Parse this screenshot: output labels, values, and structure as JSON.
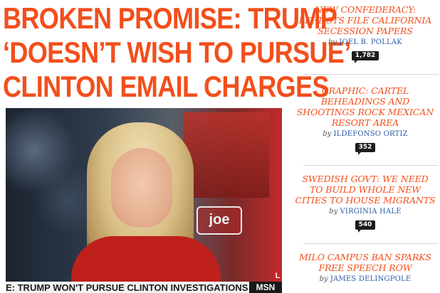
{
  "headline": {
    "lines": [
      "BROKEN PROMISE: TRUMP",
      "‘DOESN’T WISH TO PURSUE’",
      "CLINTON EMAIL CHARGES"
    ]
  },
  "photo": {
    "ticker_text": "E: TRUMP WON'T PURSUE CLINTON INVESTIGATIONS",
    "ticker_logo": "MSN",
    "corner_tag": "L",
    "show_logo": "joe"
  },
  "sidebar": {
    "stories": [
      {
        "title_lines": [
          "NEW CONFEDERACY:",
          "LEFTISTS FILE CALIFORNIA",
          "SECESSION PAPERS"
        ],
        "by": "by",
        "author": "JOEL B. POLLAK",
        "comments": "1,782"
      },
      {
        "title_lines": [
          "GRAPHIC: CARTEL",
          "BEHEADINGS AND",
          "SHOOTINGS ROCK MEXICAN",
          "RESORT AREA"
        ],
        "by": "by",
        "author": "ILDEFONSO ORTIZ",
        "comments": "352"
      },
      {
        "title_lines": [
          "SWEDISH GOVT: WE NEED",
          "TO BUILD WHOLE NEW",
          "CITIES TO HOUSE MIGRANTS"
        ],
        "by": "by",
        "author": "VIRGINIA HALE",
        "comments": "540"
      },
      {
        "title_lines": [
          "MILO CAMPUS BAN SPARKS",
          "FREE SPEECH ROW"
        ],
        "by": "by",
        "author": "JAMES DELINGPOLE",
        "comments": ""
      }
    ]
  },
  "colors": {
    "headline": "#f24f1c",
    "author_link": "#2a5aa8",
    "badge": "#1c1c1c"
  }
}
